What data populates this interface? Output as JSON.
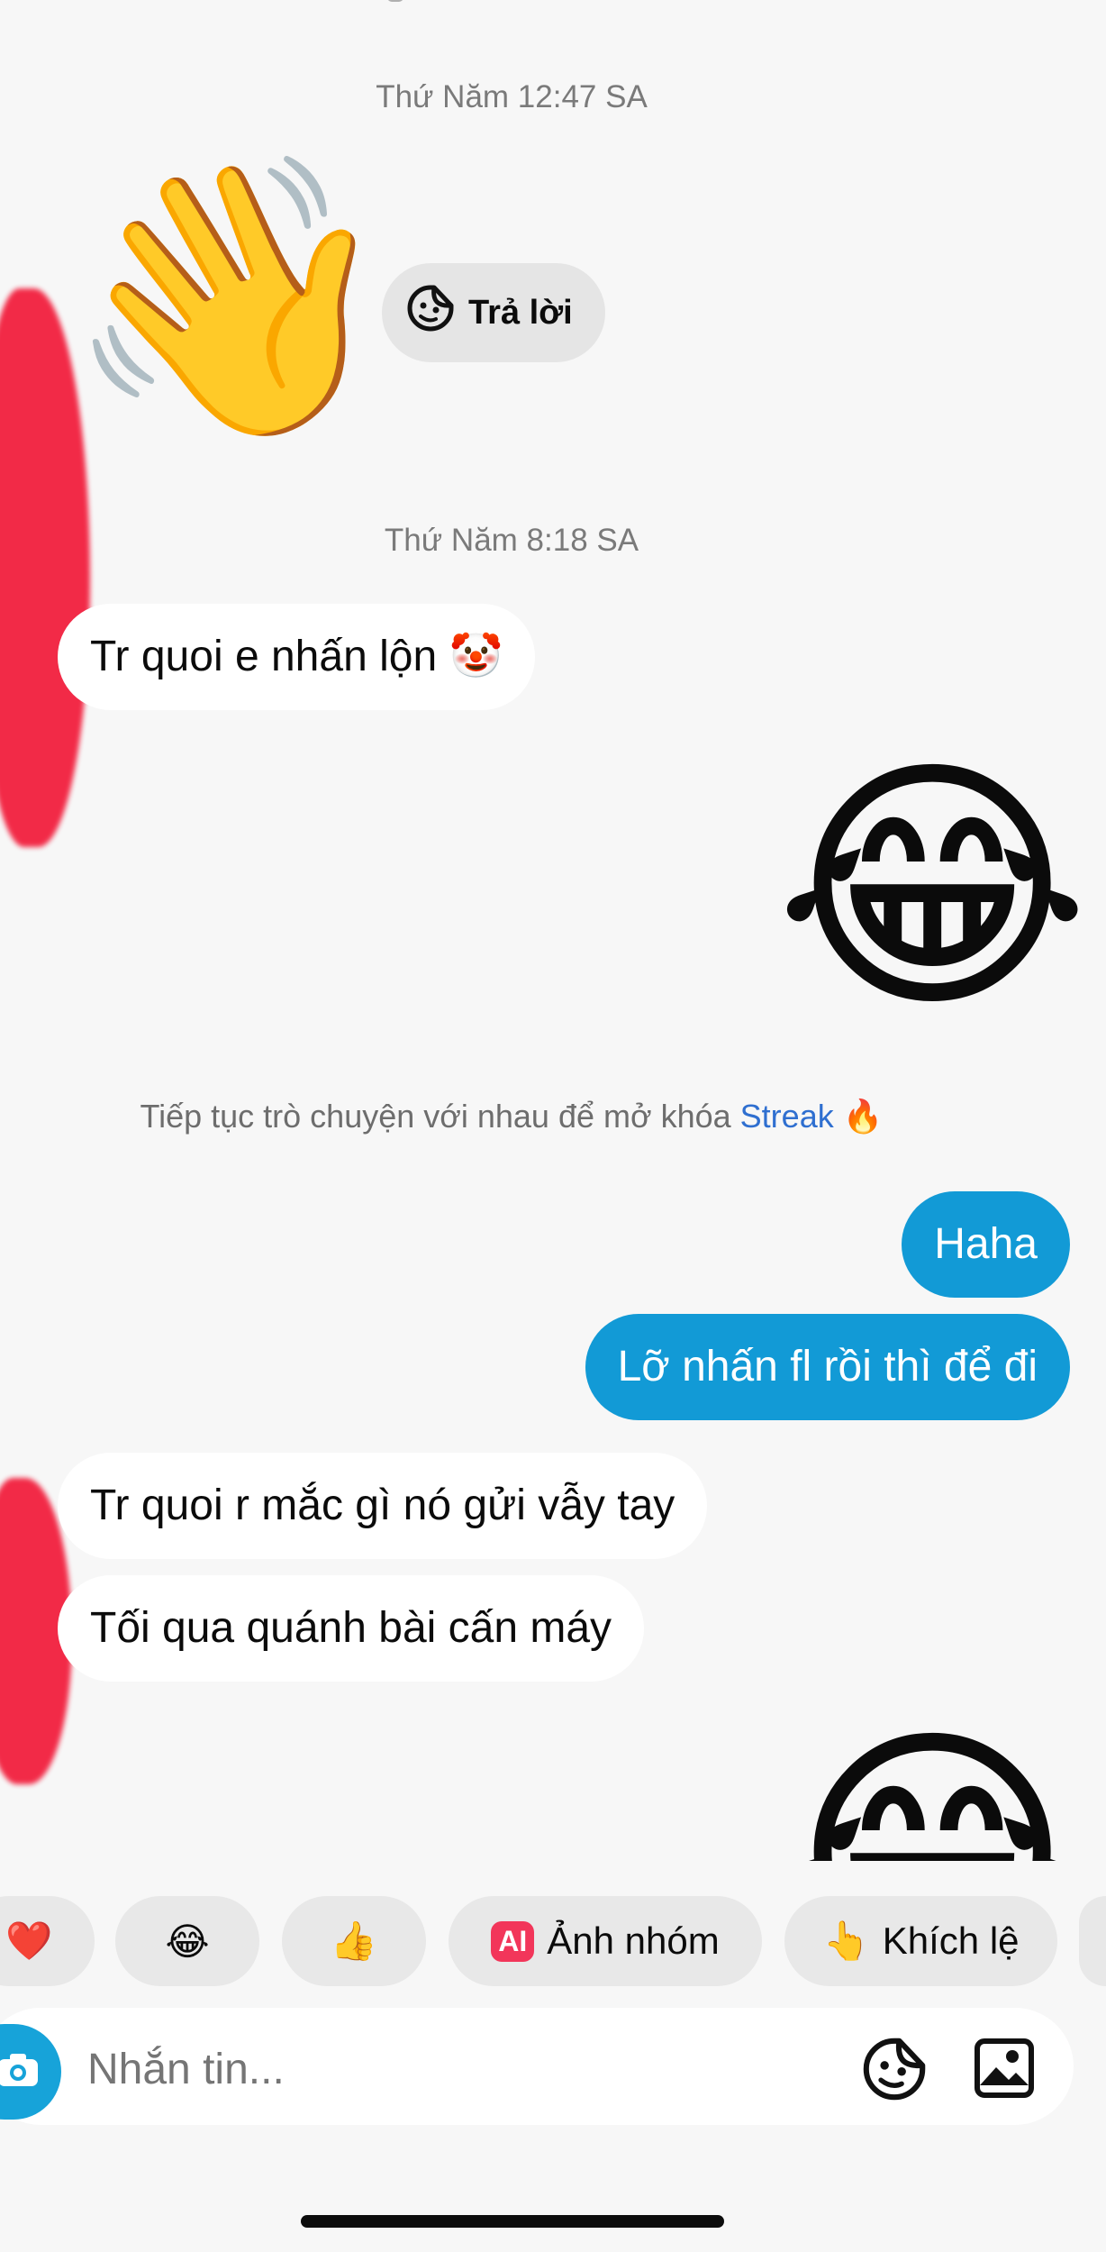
{
  "timestamps": [
    "Thứ Năm 12:47 SA",
    "Thứ Năm 8:18 SA"
  ],
  "reply_button": {
    "label": "Trả lời"
  },
  "messages": [
    {
      "from": "them",
      "text": "Tr quoi e nhấn lộn 🤡"
    },
    {
      "from": "me",
      "text": "Haha"
    },
    {
      "from": "me",
      "text": "Lỡ nhấn fl rồi thì để đi"
    },
    {
      "from": "them",
      "text": "Tr quoi r mắc gì nó gửi vẫy tay"
    },
    {
      "from": "them",
      "text": "Tối qua quánh bài cấn máy"
    }
  ],
  "stickers": {
    "wave": "👋",
    "laugh": "😂"
  },
  "streak": {
    "prefix": "Tiếp tục trò chuyện với nhau để mở khóa ",
    "link": "Streak",
    "emoji": "🔥"
  },
  "quick_replies": [
    {
      "label": "",
      "emoji": "❤️"
    },
    {
      "label": "",
      "emoji": "😂"
    },
    {
      "label": "",
      "emoji": "👍"
    },
    {
      "label": "Ảnh nhóm",
      "badge": "AI"
    },
    {
      "label": "Khích lệ",
      "emoji": "👆"
    }
  ],
  "composer": {
    "placeholder": "Nhắn tin..."
  },
  "colors": {
    "outgoing": "#129ad6",
    "incoming": "#ffffff",
    "streak_link": "#2f6fd0",
    "ai_badge": "#f2365a"
  }
}
